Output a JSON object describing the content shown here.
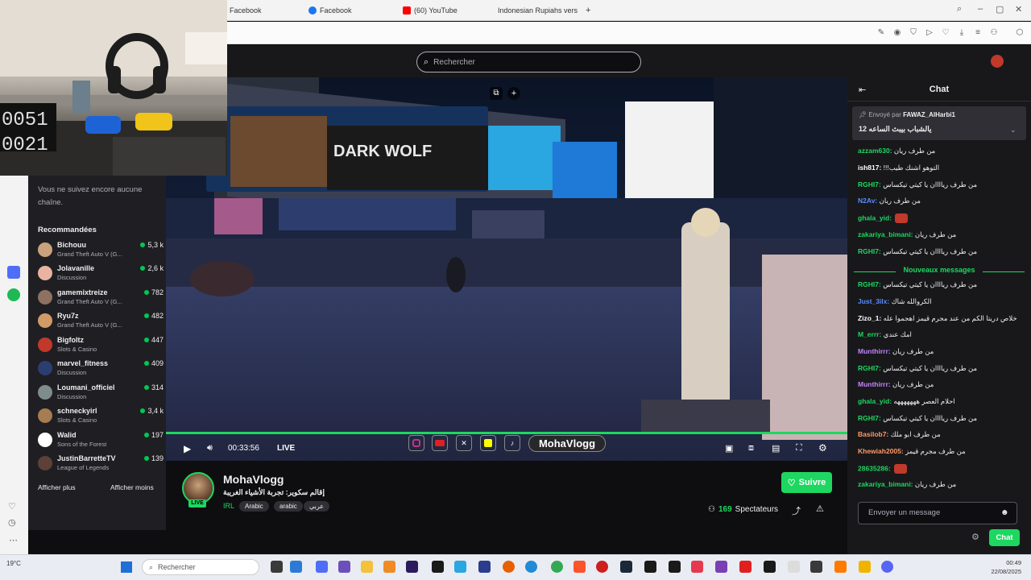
{
  "browser": {
    "tabs": [
      {
        "label": "Facebook"
      },
      {
        "label": "Facebook"
      },
      {
        "label": "(60) YouTube"
      },
      {
        "label": "Indonesian Rupiahs vers l"
      }
    ],
    "new_tab": "+"
  },
  "header": {
    "search_placeholder": "Rechercher"
  },
  "sidebar": {
    "follow_note": "Vous ne suivez encore aucune chaîne.",
    "recommended_title": "Recommandées",
    "channels": [
      {
        "name": "Bichouu",
        "game": "Grand Theft Auto V (G...",
        "viewers": "5,3 k"
      },
      {
        "name": "Jolavanille",
        "game": "Discussion",
        "viewers": "2,6 k"
      },
      {
        "name": "gamemixtreize",
        "game": "Grand Theft Auto V (G...",
        "viewers": "782"
      },
      {
        "name": "Ryu7z",
        "game": "Grand Theft Auto V (G...",
        "viewers": "482"
      },
      {
        "name": "Bigfoltz",
        "game": "Slots & Casino",
        "viewers": "447"
      },
      {
        "name": "marvel_fitness",
        "game": "Discussion",
        "viewers": "409"
      },
      {
        "name": "Loumani_officiel",
        "game": "Discussion",
        "viewers": "314"
      },
      {
        "name": "schneckyirl",
        "game": "Slots & Casino",
        "viewers": "3,4 k"
      },
      {
        "name": "Walid",
        "game": "Sons of the Forest",
        "viewers": "197"
      },
      {
        "name": "JustinBarretteTV",
        "game": "League of Legends",
        "viewers": "139"
      }
    ],
    "show_more": "Afficher plus",
    "show_less": "Afficher moins"
  },
  "player": {
    "time": "00:33:56",
    "live_label": "LIVE",
    "overlay_name": "MohaVlogg"
  },
  "channel": {
    "name": "MohaVlogg",
    "title": "إقالم سكوير: تجربة الأشياء الغريبة",
    "live_badge": "LIVE",
    "category": "IRL",
    "tags": [
      "Arabic",
      "arabic",
      "عربي"
    ],
    "follow_label": "Suivre",
    "viewers_count": "169",
    "viewers_label": "Spectateurs"
  },
  "chat": {
    "title": "Chat",
    "pinned_by_prefix": "Envoyé par",
    "pinned_by": "FAWAZ_AlHarbi1",
    "pinned_text": "يالشباب بيبث الساعه 12",
    "new_messages": "Nouveaux messages",
    "messages": [
      {
        "user": "azzam630:",
        "color": "#1ed760",
        "text": "من طرف ريان"
      },
      {
        "user": "ish817:",
        "color": "#ffffff",
        "text": "!!!التوهو اشنك طيب"
      },
      {
        "user": "RGHI7:",
        "color": "#1ed760",
        "text": "من طرف رياااان يا كيتي تيكساس"
      },
      {
        "user": "N2Av:",
        "color": "#5b8cff",
        "text": "من طرف ريان"
      },
      {
        "user": "ghala_yid:",
        "color": "#1ed760",
        "text": ""
      },
      {
        "user": "zakariya_bimani:",
        "color": "#1ed760",
        "text": "من طرف ريان"
      },
      {
        "user": "RGHI7:",
        "color": "#1ed760",
        "text": "من طرف رياااان يا كيتي تيكساس"
      },
      {
        "user": "RGHI7:",
        "color": "#1ed760",
        "text": "من طرف رياااان يا كيتي تيكساس"
      },
      {
        "user": "Just_3ilx:",
        "color": "#5b8cff",
        "text": "الكروالله شاك"
      },
      {
        "user": "Zizo_1:",
        "color": "#ffffff",
        "text": "خلاص دريتا الكم من عند مجرم قيمز اهجموا عله"
      },
      {
        "user": "M_errr:",
        "color": "#1ed760",
        "text": "امك عندي"
      },
      {
        "user": "Munthirrr:",
        "color": "#c084fc",
        "text": "من طرف ريان"
      },
      {
        "user": "RGHI7:",
        "color": "#1ed760",
        "text": "من طرف رياااان يا كيتي تيكساس"
      },
      {
        "user": "Munthirrr:",
        "color": "#c084fc",
        "text": "من طرف ريان"
      },
      {
        "user": "ghala_yid:",
        "color": "#1ed760",
        "text": "احلام العصر هههههههه"
      },
      {
        "user": "RGHI7:",
        "color": "#1ed760",
        "text": "من طرف رياااان يا كيتي تيكساس"
      },
      {
        "user": "Basilob7:",
        "color": "#ff9966",
        "text": "من طرف ابو ملك"
      },
      {
        "user": "Khewiah2005:",
        "color": "#ff9966",
        "text": "من طرف مجرم قيمز"
      },
      {
        "user": "28635286:",
        "color": "#1ed760",
        "text": ""
      },
      {
        "user": "zakariya_bimani:",
        "color": "#1ed760",
        "text": "من طرف ريان"
      }
    ],
    "input_placeholder": "Envoyer un message",
    "send_label": "Chat"
  },
  "taskbar": {
    "search_placeholder": "Rechercher",
    "weather": "19°C",
    "time": "00:49",
    "date": "22/08/2025"
  },
  "colors": {
    "accent": "#1ed760",
    "background": "#0e0e10",
    "panel": "#18181b"
  }
}
